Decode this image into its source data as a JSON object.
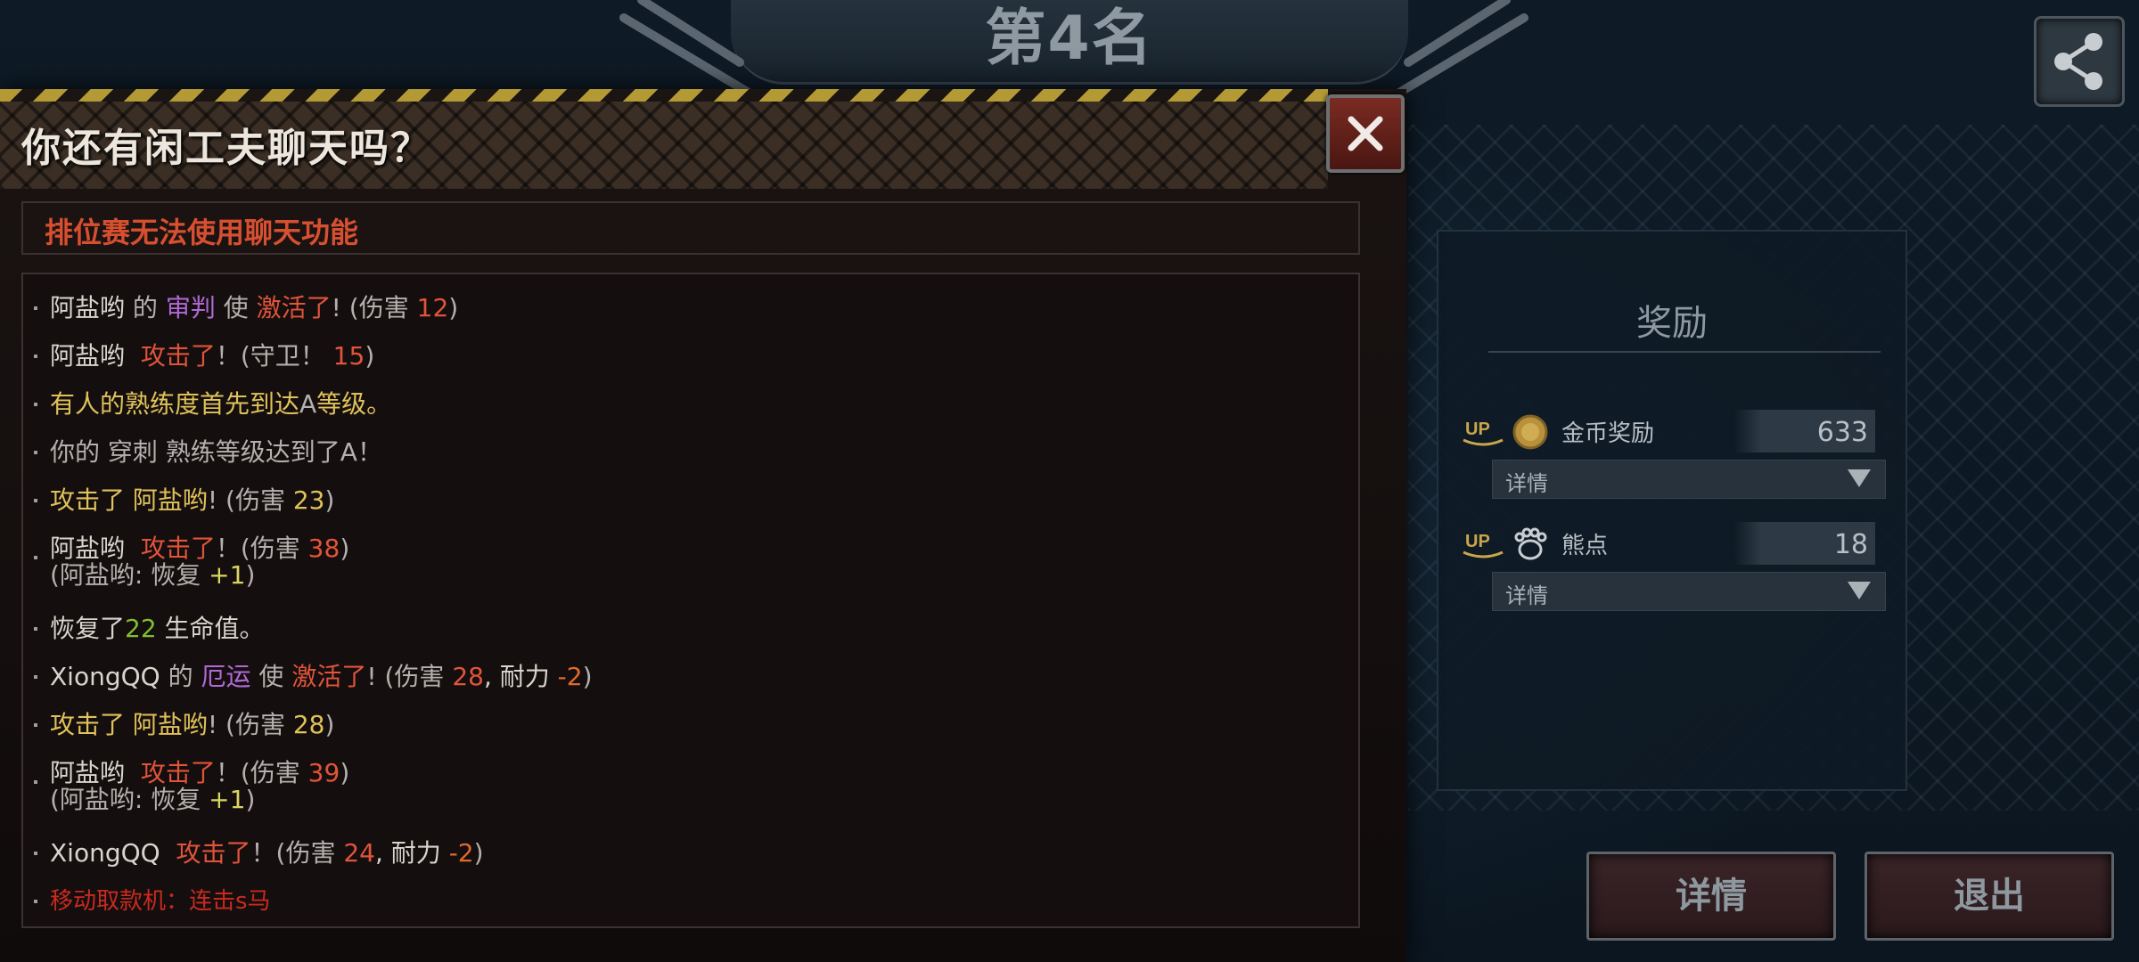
{
  "header": {
    "rank_title": "第4名"
  },
  "reward": {
    "title": "奖励",
    "rows": [
      {
        "label": "金币奖励",
        "value": "633",
        "detail": "详情",
        "up": "UP",
        "icon": "gold-coin-icon"
      },
      {
        "label": "熊点",
        "value": "18",
        "detail": "详情",
        "up": "UP",
        "icon": "bear-paw-icon"
      }
    ]
  },
  "buttons": {
    "detail": "详情",
    "exit": "退出"
  },
  "chat": {
    "title": "你还有闲工夫聊天吗？",
    "notice": "排位赛无法使用聊天功能",
    "log": [
      {
        "a": "阿盐哟",
        "b": " 的 ",
        "c": "审判",
        "d": " 使 ",
        "e": "激活了",
        "f": "! (伤害 ",
        "g": "12",
        "h": ")"
      },
      {
        "a": "阿盐哟",
        "b": "攻击了",
        "c": "！(守卫！ ",
        "d": "15",
        "e": ")"
      },
      {
        "a": "有人的熟练度首先到达",
        "b": "A",
        "c": "等级。"
      },
      {
        "a": "你的 穿刺 熟练等级达到了A！"
      },
      {
        "a": "攻击了 阿盐哟",
        "b": "! (伤害 ",
        "c": "23",
        "d": ")"
      },
      {
        "a": "阿盐哟",
        "b": "攻击了",
        "c": "！(伤害 ",
        "d": "38",
        "e": ")",
        "f": "(阿盐哟: 恢复 ",
        "g": "+1",
        "h": ")"
      },
      {
        "a": "恢复了",
        "b": "22",
        "c": " 生命值。"
      },
      {
        "a": "XiongQQ",
        "b": " 的 ",
        "c": "厄运",
        "d": " 使 ",
        "e": "激活了",
        "f": "! (伤害 ",
        "g": "28",
        "h": ", 耐力 ",
        "i": "-2",
        "j": ")"
      },
      {
        "a": "攻击了 阿盐哟",
        "b": "! (伤害 ",
        "c": "28",
        "d": ")"
      },
      {
        "a": "阿盐哟",
        "b": "攻击了",
        "c": "！(伤害 ",
        "d": "39",
        "e": ")",
        "f": "(阿盐哟: 恢复 ",
        "g": "+1",
        "h": ")"
      },
      {
        "a": "XiongQQ",
        "b": "攻击了",
        "c": "！(伤害 ",
        "d": "24",
        "e": ", 耐力 ",
        "f": "-2",
        "g": ")"
      },
      {
        "a": "移动取款机：连击s马"
      }
    ]
  },
  "icons": {
    "share": "share-icon",
    "close": "close-icon"
  }
}
